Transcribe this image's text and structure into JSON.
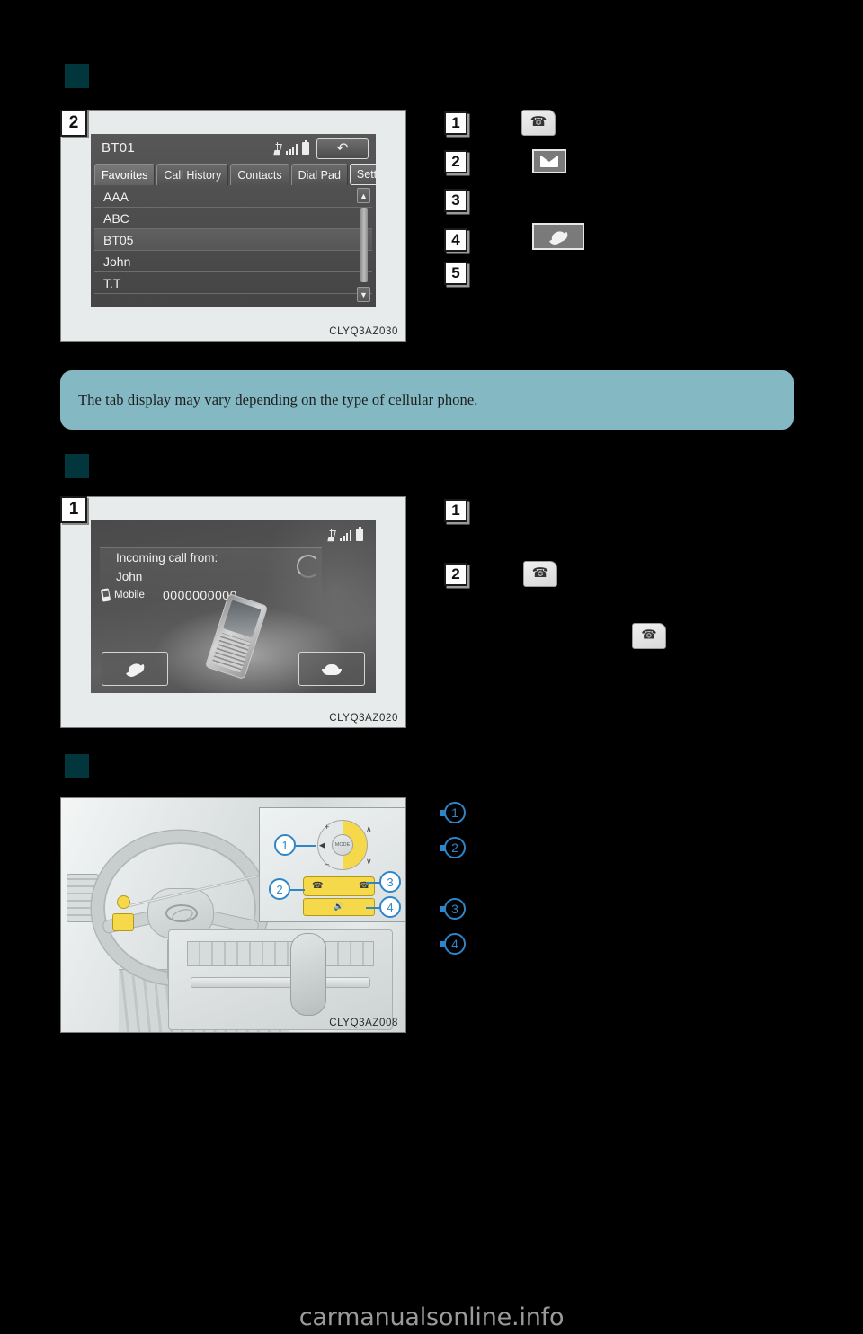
{
  "page": {
    "background_color": "#000000",
    "watermark": "carmanualsonline.info",
    "accent_teal": "#02363d",
    "callout_blue": "#2e86c8",
    "note_bg": "#84b9c4"
  },
  "sections": [
    {
      "id": "section-1",
      "marker": "",
      "figure": {
        "tag": "2",
        "code": "CLYQ3AZ030",
        "screen": {
          "title": "BT01",
          "status_icons": [
            "bluetooth-icon",
            "signal-icon",
            "battery-icon"
          ],
          "back_button": "back-arrow-icon",
          "tabs": [
            {
              "label": "Favorites",
              "state": "active"
            },
            {
              "label": "Call History",
              "state": "normal"
            },
            {
              "label": "Contacts",
              "state": "normal"
            },
            {
              "label": "Dial Pad",
              "state": "normal"
            },
            {
              "label": "Settings",
              "state": "boxed"
            },
            {
              "label": "",
              "state": "icon",
              "icon": "envelope-icon"
            }
          ],
          "list": [
            {
              "name": "AAA",
              "highlight": false
            },
            {
              "name": "ABC",
              "highlight": false
            },
            {
              "name": "BT05",
              "highlight": true
            },
            {
              "name": "John",
              "highlight": false
            },
            {
              "name": "T.T",
              "highlight": false
            }
          ],
          "scroll_up": "▲",
          "scroll_down": "▼"
        }
      },
      "steps": [
        {
          "num": "1",
          "text": "",
          "icon": "steering-wheel-phone-button"
        },
        {
          "num": "2",
          "text": "",
          "icon": "envelope-button"
        },
        {
          "num": "3",
          "text": "",
          "icon": ""
        },
        {
          "num": "4",
          "text": "",
          "icon": "offhook-handset-button"
        },
        {
          "num": "5",
          "text": "",
          "icon": ""
        }
      ]
    },
    {
      "id": "section-2",
      "marker": "",
      "figure": {
        "tag": "1",
        "code": "CLYQ3AZ020",
        "screen": {
          "status_icons": [
            "bluetooth-icon",
            "signal-icon",
            "battery-icon"
          ],
          "heading": "Incoming call from:",
          "caller_name": "John",
          "number_label": "Mobile",
          "number": "0000000000",
          "answer_button": "answer-handset-icon",
          "decline_button": "decline-handset-icon"
        }
      },
      "steps": [
        {
          "num": "1",
          "text": "",
          "icon": ""
        },
        {
          "num": "2",
          "text": "",
          "icon": "steering-wheel-phone-button"
        }
      ],
      "extra_icon": "steering-wheel-hangup-button"
    },
    {
      "id": "section-3",
      "marker": "",
      "figure": {
        "code": "CLYQ3AZ008",
        "description": "vehicle-interior-steering-wheel-controls",
        "inset_callouts": [
          "1",
          "2",
          "3",
          "4"
        ],
        "inset_center_label": "MODE"
      },
      "steps": [
        {
          "num": "1",
          "text": ""
        },
        {
          "num": "2",
          "text": ""
        },
        {
          "num": "3",
          "text": ""
        },
        {
          "num": "4",
          "text": ""
        }
      ]
    }
  ],
  "note": {
    "text": "The tab display may vary depending on the type of cellular phone."
  }
}
